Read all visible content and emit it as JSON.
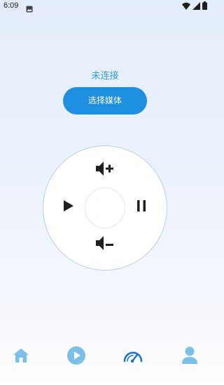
{
  "status_bar": {
    "time": "6:09",
    "icons": [
      "gallery-icon",
      "wifi-icon",
      "signal-icon",
      "battery-icon"
    ]
  },
  "connection": {
    "status": "未连接"
  },
  "actions": {
    "select_media_label": "选择媒体"
  },
  "remote": {
    "buttons": [
      "volume-up-icon",
      "play-icon",
      "pause-icon",
      "volume-down-icon"
    ]
  },
  "bottom_nav": {
    "items": [
      "home-icon",
      "play-circle-icon",
      "dashboard-icon",
      "user-icon"
    ],
    "active": "dashboard-icon"
  },
  "colors": {
    "accent": "#1e8fe0",
    "status_text": "#2e9ad6",
    "icon_dark": "#1f1f1f",
    "nav_icon": "#7cc0ea",
    "nav_active": "#1a73c9"
  }
}
